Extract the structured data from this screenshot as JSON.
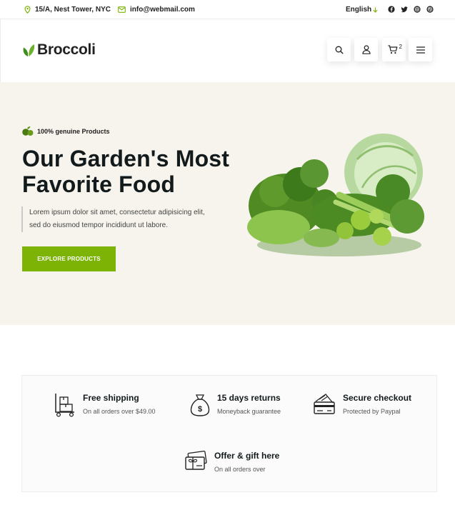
{
  "topbar": {
    "address": "15/A, Nest Tower, NYC",
    "email": "info@webmail.com",
    "language": "English",
    "social_icons": [
      "facebook-icon",
      "twitter-icon",
      "instagram-icon",
      "dribbble-icon"
    ]
  },
  "header": {
    "logo_text": "Broccoli",
    "cart_count": "2",
    "icons": [
      "search-icon",
      "user-icon",
      "cart-icon",
      "menu-icon"
    ]
  },
  "hero": {
    "badge": "100% genuine Products",
    "title_line1": "Our Garden's Most",
    "title_line2": "Favorite Food",
    "desc_line1": "Lorem ipsum dolor sit amet, consectetur adipisicing elit,",
    "desc_line2": "sed do eiusmod tempor incididunt ut labore.",
    "button": "EXPLORE PRODUCTS"
  },
  "features": [
    {
      "title": "Free shipping",
      "subtitle": "On all orders over $49.00",
      "icon": "delivery-trolley-icon"
    },
    {
      "title": "15 days returns",
      "subtitle": "Moneyback guarantee",
      "icon": "money-bag-icon"
    },
    {
      "title": "Secure checkout",
      "subtitle": "Protected by Paypal",
      "icon": "credit-card-icon"
    },
    {
      "title": "Offer & gift here",
      "subtitle": "On all orders over",
      "icon": "gift-voucher-icon"
    }
  ],
  "colors": {
    "accent": "#7cb305",
    "hero_bg": "#f6f4ec",
    "dark_text": "#121a1c"
  }
}
